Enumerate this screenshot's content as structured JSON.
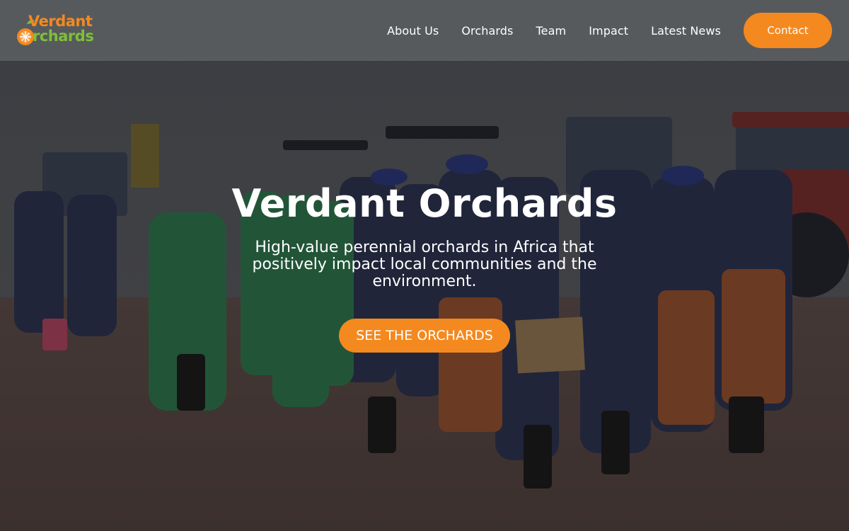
{
  "brand": {
    "line1": "Verdant",
    "line2": "rchards",
    "orange": "#f4891f",
    "green": "#7ebf3a",
    "icon": "orange-fruit-icon"
  },
  "nav": {
    "links": [
      "About Us",
      "Orchards",
      "Team",
      "Impact",
      "Latest News"
    ],
    "contact_label": "Contact"
  },
  "hero": {
    "title": "Verdant Orchards",
    "subtitle": "High-value perennial orchards in Africa that positively impact local communities and the environment.",
    "cta_label": "SEE THE ORCHARDS",
    "background": "photo of orchard workers in uniforms standing in front of tractors"
  },
  "colors": {
    "accent": "#f4891f",
    "navbar": "#5a5c60",
    "text": "#ffffff"
  }
}
